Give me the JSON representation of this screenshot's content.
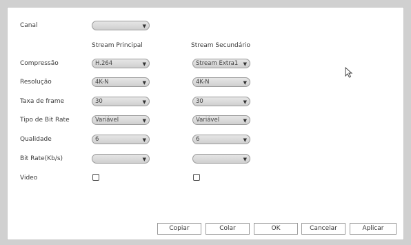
{
  "labels": {
    "canal": "Canal",
    "compressao": "Compressão",
    "resolucao": "Resolução",
    "taxa": "Taxa de frame",
    "tipo": "Tipo de Bit Rate",
    "qualidade": "Qualidade",
    "bitrate": "Bit Rate(Kb/s)",
    "video": "Video"
  },
  "columns": {
    "main": "Stream Principal",
    "sub": "Stream Secundário"
  },
  "main": {
    "canal": "",
    "compressao": "H.264",
    "resolucao": "4K-N",
    "taxa": "30",
    "tipo": "Variável",
    "qualidade": "6",
    "bitrate": ""
  },
  "sub": {
    "compressao": "Stream Extra1",
    "resolucao": "4K-N",
    "taxa": "30",
    "tipo": "Variável",
    "qualidade": "6",
    "bitrate": ""
  },
  "buttons": {
    "copiar": "Copiar",
    "colar": "Colar",
    "ok": "OK",
    "cancelar": "Cancelar",
    "aplicar": "Aplicar"
  },
  "icons": {
    "dropdown": "▼"
  }
}
